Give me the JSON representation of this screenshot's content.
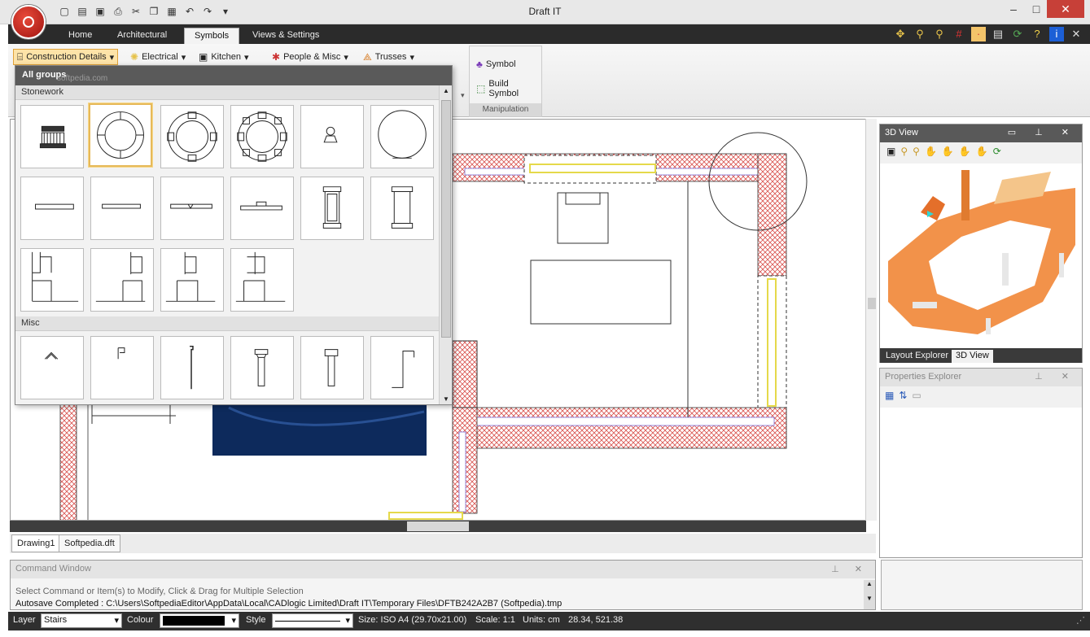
{
  "app": {
    "title": "Draft IT"
  },
  "qat": {
    "icons": [
      "new-icon",
      "open-icon",
      "save-icon",
      "print-icon",
      "cut-icon",
      "copy-icon",
      "paste-icon",
      "undo-icon",
      "redo-icon"
    ]
  },
  "tabs": [
    "Home",
    "Architectural",
    "Symbols",
    "Views & Settings"
  ],
  "ribbon": {
    "construction": "Construction Details",
    "electrical": "Electrical",
    "kitchen": "Kitchen",
    "people": "People & Misc",
    "trusses": "Trusses",
    "symbol": "Symbol",
    "build_symbol": "Build Symbol",
    "manipulation": "Manipulation",
    "watermark": "softpedia.com"
  },
  "symbols": {
    "all_groups": "All groups",
    "group_stonework": "Stonework",
    "group_misc": "Misc"
  },
  "doc_tabs": [
    "Drawing1",
    "Softpedia.dft"
  ],
  "panel3d": {
    "title": "3D View",
    "tabs": [
      "Layout Explorer",
      "3D View"
    ]
  },
  "props": {
    "title": "Properties Explorer"
  },
  "command": {
    "title": "Command Window",
    "line1": "Select Command or Item(s) to Modify, Click & Drag for Multiple Selection",
    "line2": "Autosave Completed : C:\\Users\\SoftpediaEditor\\AppData\\Local\\CADlogic Limited\\Draft IT\\Temporary Files\\DFTB242A2B7 (Softpedia).tmp"
  },
  "status": {
    "layer_label": "Layer",
    "layer_value": "Stairs",
    "colour_label": "Colour",
    "style_label": "Style",
    "size": "Size: ISO A4 (29.70x21.00)",
    "scale": "Scale: 1:1",
    "units": "Units: cm",
    "coords": "28.34, 521.38"
  },
  "colors": {
    "accent": "#e0a23b",
    "wall_hatch": "#d9534f",
    "window": "#f1e27a",
    "dark_bar": "#2f2f2f"
  }
}
